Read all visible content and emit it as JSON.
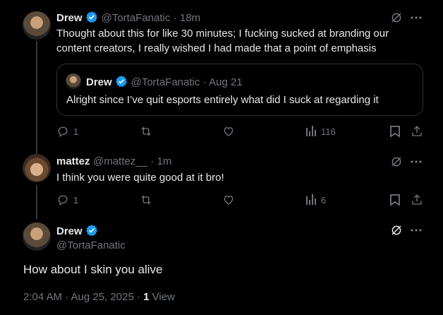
{
  "tweets": [
    {
      "name": "Drew",
      "handle": "@TortaFanatic",
      "time": "· 18m",
      "text_line1": "Thought about this for like 30 minutes; I fucking sucked at branding our",
      "text_line2": "content creators, I really wished I had made that a point of emphasis",
      "quote": {
        "name": "Drew",
        "handle": "@TortaFanatic",
        "time": "· Aug 21",
        "text": "Alright since I’ve quit esports entirely what did I suck at regarding it"
      },
      "replies": "1",
      "views": "116"
    },
    {
      "name": "mattez",
      "handle": "@mattez__",
      "time": "· 1m",
      "text": "I think you were quite good at it bro!",
      "replies": "1",
      "views": "6"
    }
  ],
  "focused": {
    "name": "Drew",
    "handle": "@TortaFanatic",
    "text": "How about I skin you alive",
    "timestamp": "2:04 AM · Aug 25, 2025 · ",
    "view_count": "1",
    "view_label": " View"
  },
  "colors": {
    "background": "#000000",
    "text": "#e7e9ea",
    "muted": "#71767b",
    "verified": "#1d9bf0",
    "border": "#2f3336"
  },
  "icons": [
    "grok-icon",
    "more-icon",
    "reply-icon",
    "retweet-icon",
    "like-icon",
    "views-icon",
    "bookmark-icon",
    "share-icon",
    "verified-badge-icon"
  ]
}
